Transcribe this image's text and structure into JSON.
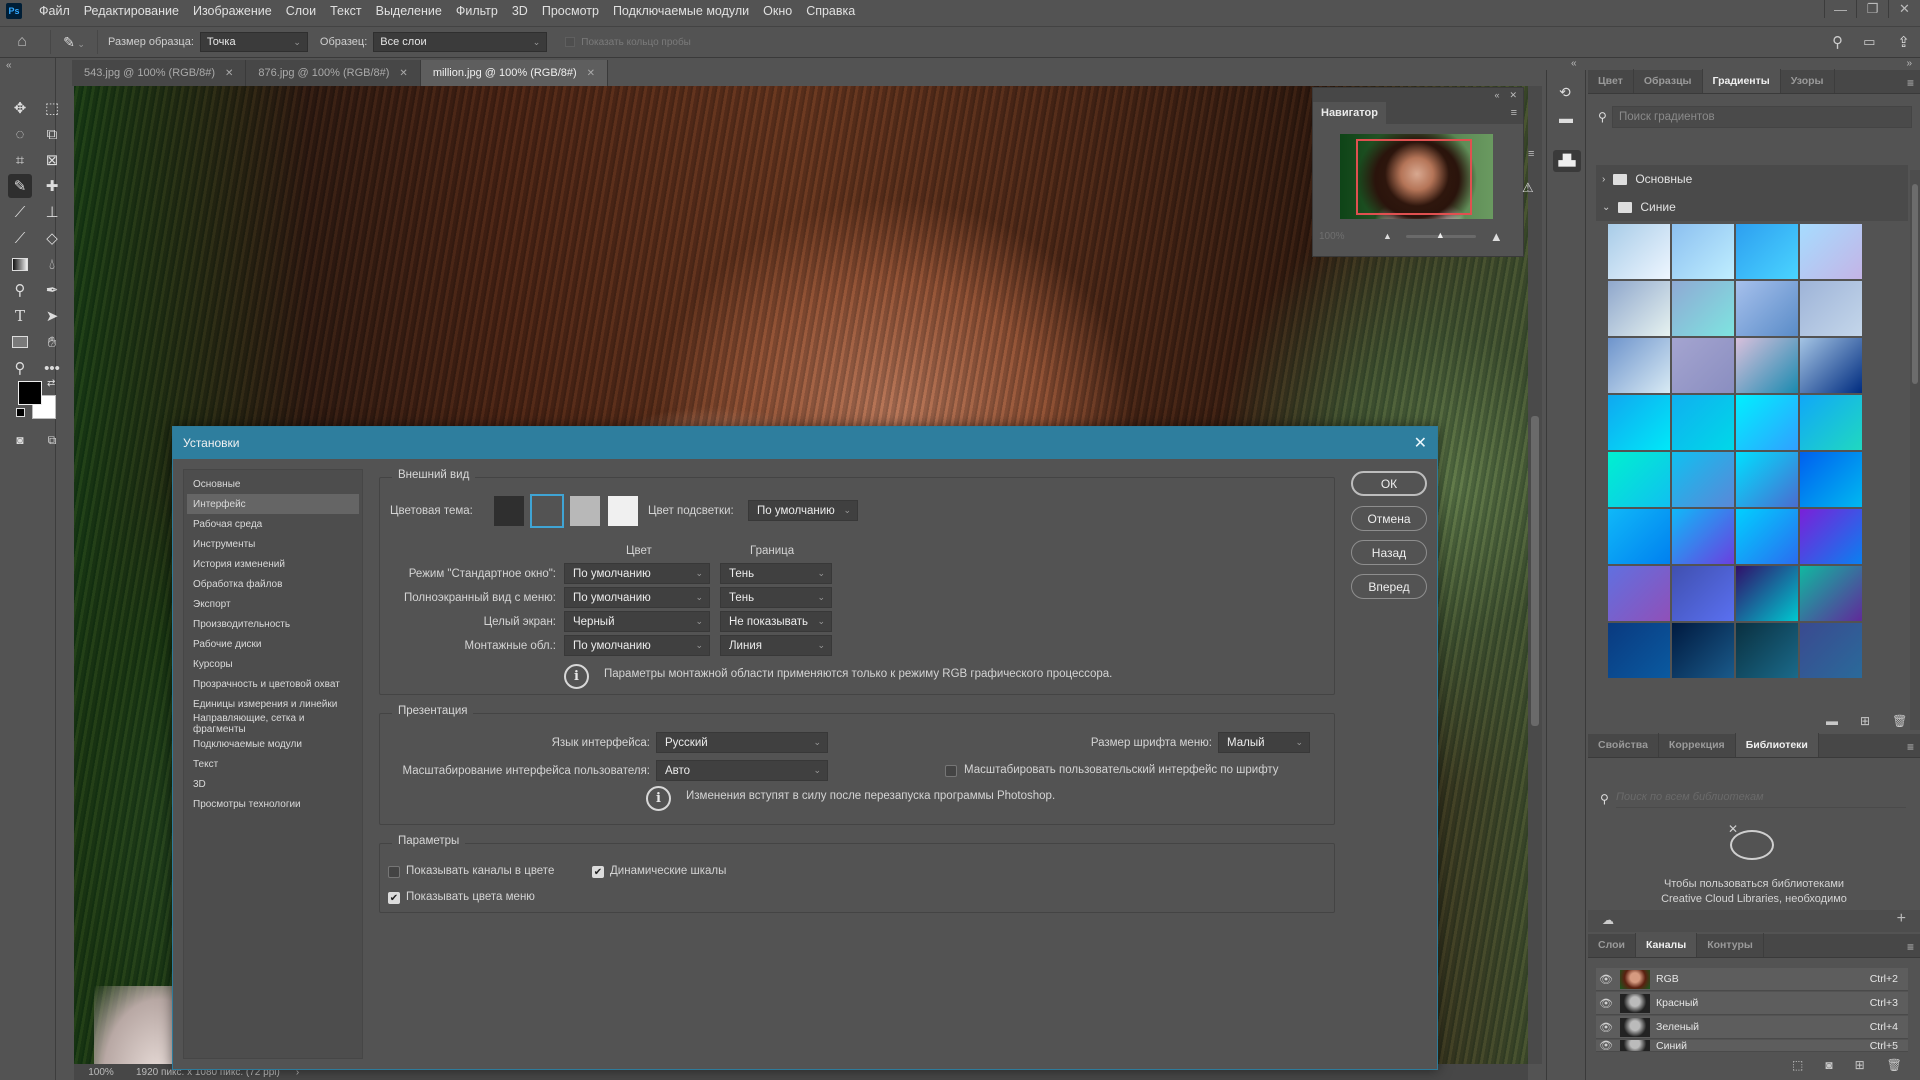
{
  "app": {
    "logo": "Ps"
  },
  "menubar": {
    "items": [
      "Файл",
      "Редактирование",
      "Изображение",
      "Слои",
      "Текст",
      "Выделение",
      "Фильтр",
      "3D",
      "Просмотр",
      "Подключаемые модули",
      "Окно",
      "Справка"
    ],
    "window_controls": {
      "minimize": "—",
      "restore": "❐",
      "close": "✕"
    }
  },
  "options_bar": {
    "home_icon": "home-icon",
    "tool_icon": "eyedropper-icon",
    "sample_size_label": "Размер образца:",
    "sample_size_value": "Точка",
    "sample_label": "Образец:",
    "sample_value": "Все слои",
    "show_ring_label": "Показать кольцо пробы",
    "show_ring_checked": false
  },
  "doc_tabs": [
    {
      "label": "543.jpg @ 100% (RGB/8#)",
      "active": false
    },
    {
      "label": "876.jpg @ 100% (RGB/8#)",
      "active": false
    },
    {
      "label": "million.jpg @ 100% (RGB/8#)",
      "active": true
    }
  ],
  "tools": [
    "move-tool",
    "marquee-tool",
    "lasso-tool",
    "object-selection-tool",
    "crop-tool",
    "frame-tool",
    "eyedropper-tool",
    "healing-brush-tool",
    "brush-tool",
    "clone-stamp-tool",
    "history-brush-tool",
    "eraser-tool",
    "gradient-tool",
    "blur-tool",
    "dodge-tool",
    "pen-tool",
    "type-tool",
    "path-selection-tool",
    "rectangle-tool",
    "hand-tool",
    "zoom-tool",
    "more-tools"
  ],
  "colors": {
    "foreground": "#000000",
    "background": "#ffffff",
    "accent": "#2e7e9e",
    "nav_view": "#e05050"
  },
  "status": {
    "zoom": "100%",
    "doc_info": "1920 пикс. x 1080 пикс. (72 ppi)"
  },
  "navigator": {
    "title": "Навигатор",
    "zoom": "100%"
  },
  "gradients_panel": {
    "tabs": [
      {
        "label": "Цвет",
        "active": false
      },
      {
        "label": "Образцы",
        "active": false
      },
      {
        "label": "Градиенты",
        "active": true
      },
      {
        "label": "Узоры",
        "active": false
      }
    ],
    "search_placeholder": "Поиск градиентов",
    "groups": [
      {
        "name": "Основные",
        "expanded": false
      },
      {
        "name": "Синие",
        "expanded": true
      }
    ],
    "swatches": [
      [
        "#a8cce8",
        "#eef6ff"
      ],
      [
        "#8cc0f0",
        "#bfeeff"
      ],
      [
        "#2d9ff0",
        "#4ad4ff"
      ],
      [
        "#a6dcff",
        "#c4b4e6"
      ],
      [
        "#8fa7cc",
        "#e6f2f0"
      ],
      [
        "#8fa9d4",
        "#7ee4e0"
      ],
      [
        "#a6c0ec",
        "#5a8cc8"
      ],
      [
        "#9eb4d8",
        "#c4d6ea"
      ],
      [
        "#6e94cc",
        "#d8eaf4"
      ],
      [
        "#a4a4d0",
        "#8a8ec0"
      ],
      [
        "#d8c0dc",
        "#1a8ab0"
      ],
      [
        "#a4c4e4",
        "#002c80"
      ],
      [
        "#10a8f0",
        "#00e8f8"
      ],
      [
        "#10b0f0",
        "#00d8e8"
      ],
      [
        "#00f0ff",
        "#30a0ff"
      ],
      [
        "#10a8f8",
        "#20d8c0"
      ],
      [
        "#00f0d0",
        "#10c0f0"
      ],
      [
        "#10c0f0",
        "#5a88d8"
      ],
      [
        "#00e0ff",
        "#4a6cd0"
      ],
      [
        "#0060f0",
        "#00b8f0"
      ],
      [
        "#10b8f8",
        "#0080f0"
      ],
      [
        "#10b8f8",
        "#6a40e0"
      ],
      [
        "#00d0ff",
        "#2a6cf0"
      ],
      [
        "#7a20d8",
        "#0a80f0"
      ],
      [
        "#6070e0",
        "#9050b8"
      ],
      [
        "#4050b0",
        "#5a70f0"
      ],
      [
        "#30106a",
        "#00c8d0"
      ],
      [
        "#10b8a0",
        "#602a9a"
      ],
      [
        "#0a3a80",
        "#0a5aa0"
      ],
      [
        "#001a40",
        "#1a5a8a"
      ],
      [
        "#0a3040",
        "#1a6a8a"
      ],
      [
        "#3a4a90",
        "#2a6a9a"
      ]
    ],
    "footer_icons": [
      "new-folder-icon",
      "new-gradient-icon",
      "delete-icon"
    ]
  },
  "libraries_panel": {
    "tabs": [
      {
        "label": "Свойства",
        "active": false
      },
      {
        "label": "Коррекция",
        "active": false
      },
      {
        "label": "Библиотеки",
        "active": true
      }
    ],
    "search_placeholder": "Поиск по всем библиотекам",
    "message_line1": "Чтобы пользоваться библиотеками",
    "message_line2": "Creative Cloud Libraries, необходимо"
  },
  "channels_panel": {
    "tabs": [
      {
        "label": "Слои",
        "active": false
      },
      {
        "label": "Каналы",
        "active": true
      },
      {
        "label": "Контуры",
        "active": false
      }
    ],
    "rows": [
      {
        "name": "RGB",
        "shortcut": "Ctrl+2",
        "visible": true
      },
      {
        "name": "Красный",
        "shortcut": "Ctrl+3",
        "visible": true
      },
      {
        "name": "Зеленый",
        "shortcut": "Ctrl+4",
        "visible": true
      },
      {
        "name": "Синий",
        "shortcut": "Ctrl+5",
        "visible": true
      }
    ]
  },
  "dialog": {
    "title": "Установки",
    "nav": [
      {
        "label": "Основные",
        "active": false
      },
      {
        "label": "Интерфейс",
        "active": true
      },
      {
        "label": "Рабочая среда",
        "active": false
      },
      {
        "label": "Инструменты",
        "active": false
      },
      {
        "label": "История изменений",
        "active": false
      },
      {
        "label": "Обработка файлов",
        "active": false
      },
      {
        "label": "Экспорт",
        "active": false
      },
      {
        "label": "Производительность",
        "active": false
      },
      {
        "label": "Рабочие диски",
        "active": false
      },
      {
        "label": "Курсоры",
        "active": false
      },
      {
        "label": "Прозрачность и цветовой охват",
        "active": false
      },
      {
        "label": "Единицы измерения и линейки",
        "active": false
      },
      {
        "label": "Направляющие, сетка и фрагменты",
        "active": false
      },
      {
        "label": "Подключаемые модули",
        "active": false
      },
      {
        "label": "Текст",
        "active": false
      },
      {
        "label": "3D",
        "active": false
      },
      {
        "label": "Просмотры технологии",
        "active": false
      }
    ],
    "buttons": {
      "ok": "ОК",
      "cancel": "Отмена",
      "back": "Назад",
      "forward": "Вперед"
    },
    "appearance": {
      "legend": "Внешний вид",
      "theme_label": "Цветовая тема:",
      "themes": [
        "#2f2f2f",
        "#535353",
        "#b8b8b8",
        "#f0f0f0"
      ],
      "selected_theme": 1,
      "highlight_label": "Цвет подсветки:",
      "highlight_value": "По умолчанию",
      "col_color": "Цвет",
      "col_border": "Граница",
      "rows": [
        {
          "label": "Режим \"Стандартное окно\":",
          "color": "По умолчанию",
          "border": "Тень"
        },
        {
          "label": "Полноэкранный вид с меню:",
          "color": "По умолчанию",
          "border": "Тень"
        },
        {
          "label": "Целый экран:",
          "color": "Черный",
          "border": "Не показывать"
        },
        {
          "label": "Монтажные обл.:",
          "color": "По умолчанию",
          "border": "Линия"
        }
      ],
      "note": "Параметры монтажной области применяются только к режиму RGB графического процессора."
    },
    "presentation": {
      "legend": "Презентация",
      "language_label": "Язык интерфейса:",
      "language_value": "Русский",
      "scaling_label": "Масштабирование интерфейса пользователя:",
      "scaling_value": "Авто",
      "font_size_label": "Размер шрифта меню:",
      "font_size_value": "Малый",
      "scale_to_font_label": "Масштабировать пользовательский интерфейс по шрифту",
      "scale_to_font_checked": false,
      "note": "Изменения вступят в силу после перезапуска программы Photoshop."
    },
    "options": {
      "legend": "Параметры",
      "show_channels_color_label": "Показывать каналы в цвете",
      "show_channels_color_checked": false,
      "dynamic_sliders_label": "Динамические шкалы",
      "dynamic_sliders_checked": true,
      "show_menu_colors_label": "Показывать цвета меню",
      "show_menu_colors_checked": true
    }
  }
}
